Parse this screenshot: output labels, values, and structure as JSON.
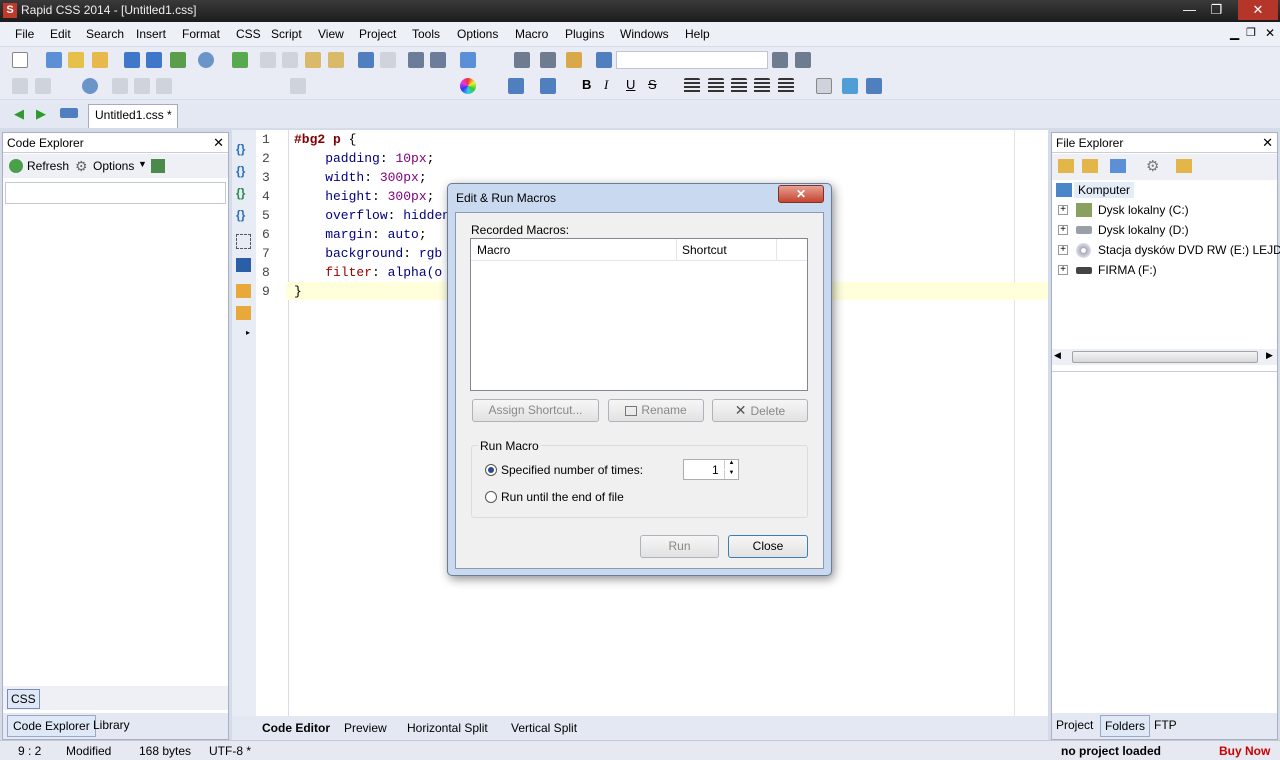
{
  "window": {
    "title": "Rapid CSS 2014 - [Untitled1.css]",
    "app_icon": "S",
    "min": "—",
    "max": "❐",
    "close": "✕"
  },
  "menu": [
    "File",
    "Edit",
    "Search",
    "Insert",
    "Format",
    "CSS",
    "Script",
    "View",
    "Project",
    "Tools",
    "Options",
    "Macro",
    "Plugins",
    "Windows",
    "Help"
  ],
  "tabs": {
    "document": "Untitled1.css *"
  },
  "code_explorer": {
    "title": "Code Explorer",
    "refresh": "Refresh",
    "options": "Options",
    "css_tab": "CSS",
    "bottom_tabs": [
      "Code Explorer",
      "Library"
    ]
  },
  "editor": {
    "line_numbers": [
      "1",
      "2",
      "3",
      "4",
      "5",
      "6",
      "7",
      "8",
      "9"
    ],
    "lines": [
      [
        {
          "t": "#bg2 p ",
          "c": "c-sel"
        },
        {
          "t": "{",
          "c": ""
        }
      ],
      [
        {
          "t": "    padding",
          "c": "c-prop"
        },
        {
          "t": ": ",
          "c": ""
        },
        {
          "t": "10px",
          "c": "c-num"
        },
        {
          "t": ";",
          "c": ""
        }
      ],
      [
        {
          "t": "    width",
          "c": "c-prop"
        },
        {
          "t": ": ",
          "c": ""
        },
        {
          "t": "300px",
          "c": "c-num"
        },
        {
          "t": ";",
          "c": ""
        }
      ],
      [
        {
          "t": "    height",
          "c": "c-prop"
        },
        {
          "t": ": ",
          "c": ""
        },
        {
          "t": "300px",
          "c": "c-num"
        },
        {
          "t": ";",
          "c": ""
        }
      ],
      [
        {
          "t": "    overflow",
          "c": "c-prop"
        },
        {
          "t": ": ",
          "c": ""
        },
        {
          "t": "hidden",
          "c": "c-prop"
        }
      ],
      [
        {
          "t": "    margin",
          "c": "c-prop"
        },
        {
          "t": ": ",
          "c": ""
        },
        {
          "t": "auto",
          "c": "c-prop"
        },
        {
          "t": ";",
          "c": ""
        }
      ],
      [
        {
          "t": "    background",
          "c": "c-prop"
        },
        {
          "t": ": ",
          "c": ""
        },
        {
          "t": "rgb",
          "c": "c-prop"
        }
      ],
      [
        {
          "t": "    filter",
          "c": "c-fn"
        },
        {
          "t": ": ",
          "c": ""
        },
        {
          "t": "alpha(o",
          "c": "c-prop"
        }
      ],
      [
        {
          "t": "}",
          "c": ""
        }
      ]
    ],
    "bottom_tabs": [
      "Code Editor",
      "Preview",
      "Horizontal Split",
      "Vertical Split"
    ]
  },
  "file_explorer": {
    "title": "File Explorer",
    "root": "Komputer",
    "items": [
      "Dysk lokalny (C:)",
      "Dysk lokalny (D:)",
      "Stacja dysków DVD RW (E:) LEJDIS",
      "FIRMA (F:)"
    ],
    "bottom_tabs": [
      "Project",
      "Folders",
      "FTP"
    ]
  },
  "dialog": {
    "title": "Edit & Run Macros",
    "recorded_label": "Recorded Macros:",
    "columns": [
      "Macro",
      "Shortcut"
    ],
    "assign": "Assign Shortcut...",
    "rename": "Rename",
    "delete": "Delete",
    "run_group": "Run Macro",
    "opt_times": "Specified number of times:",
    "times_value": "1",
    "opt_eof": "Run until the end of file",
    "run": "Run",
    "close": "Close"
  },
  "status": {
    "position": "9 : 2",
    "modified": "Modified",
    "size": "168 bytes",
    "encoding": "UTF-8 *",
    "project": "no project loaded",
    "buy": "Buy Now"
  }
}
